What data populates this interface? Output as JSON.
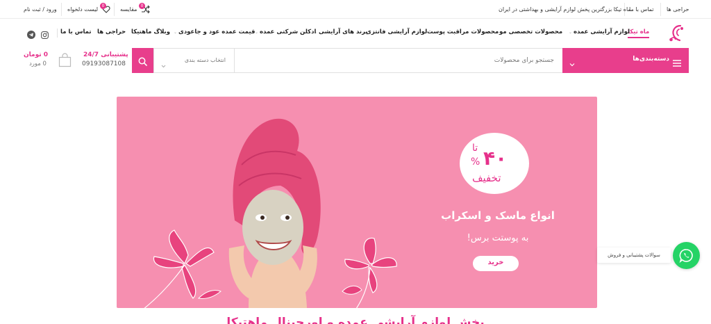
{
  "topbar": {
    "auctions": "حراجی ها",
    "contact": "تماس با ما",
    "tagline": "ماه تیکا بزرگترین پخش لوازم آرایشی و بهداشتی در ایران",
    "compare_label": "مقایسه",
    "compare_count": "0",
    "wishlist_label": "لیست دلخواه",
    "wishlist_count": "0",
    "login_label": "ورود / ثبت نام"
  },
  "nav": {
    "items": [
      "ماه تیکا",
      "لوازم آرایشی عمده",
      "محصولات تخصصی مو",
      "محصولات مراقبت پوست",
      "لوازم آرایشی فانتزی",
      "برند های آرایشی",
      "ادکلن شرکتی عمده",
      "قیمت عمده عود و جاعودی",
      "وبلاگ ماهتیکا",
      "حراجی ها",
      "تماس با ما"
    ]
  },
  "header": {
    "categories_label": "دسته‌بندی‌ها",
    "search_placeholder": "جستجو برای محصولات",
    "category_select": "انتخاب دسته بندی",
    "support_title": "پشتیبانی 24/7",
    "support_phone": "09193087108",
    "cart_total": "0 تومان",
    "cart_count": "0 مورد"
  },
  "hero": {
    "discount_top": "تا",
    "discount_value": "۴۰",
    "discount_percent": "%",
    "discount_word": "تخفیف",
    "headline": "انواع ماسک و اسکراب",
    "subline": "به پوستت برس!",
    "buy_button": "خرید"
  },
  "section_title": "پخش لوازم آرایشی عمده و اورجینال ماهتیکا",
  "whatsapp": {
    "label": "سوالات پشتیبانی و فروش"
  },
  "colors": {
    "accent": "#e6318b",
    "button_pink": "#e83e8c",
    "hero_bg": "#f68fb0",
    "whatsapp": "#25d366"
  }
}
